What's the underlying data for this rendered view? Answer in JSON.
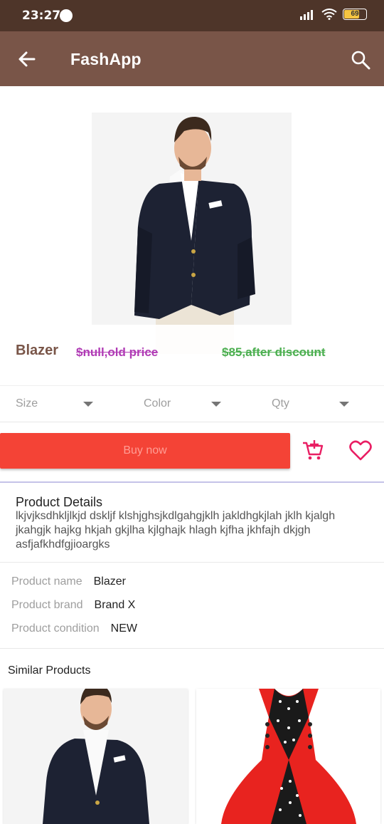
{
  "status": {
    "time": "23:27",
    "battery": "69"
  },
  "appbar": {
    "title": "FashApp"
  },
  "product": {
    "name": "Blazer",
    "old_price": "$null,old price",
    "new_price": "$85,after discount"
  },
  "selectors": {
    "size": "Size",
    "color": "Color",
    "qty": "Qty"
  },
  "actions": {
    "buy_now": "Buy now"
  },
  "details": {
    "title": "Product Details",
    "body": "lkjvjksdhkljlkjd dskljf klshjghsjkdlgahgjklh jakldhgkjlah jklh kjalgh jkahgjk hajkg hkjah gkjlha kjlghajk hlagh kjfha jkhfajh dkjgh asfjafkhdfgjioargks"
  },
  "info": [
    {
      "label": "Product name",
      "value": "Blazer"
    },
    {
      "label": "Product brand",
      "value": "Brand X"
    },
    {
      "label": "Product condition",
      "value": "NEW"
    }
  ],
  "similar": {
    "title": "Similar Products"
  },
  "colors": {
    "statusbar": "#4e3529",
    "appbar": "#795548",
    "buy": "#f44336",
    "accent": "#e91e63",
    "old_price": "#b03bb5",
    "new_price": "#4caf50"
  },
  "icons": [
    "back-arrow-icon",
    "search-icon",
    "add-to-cart-icon",
    "heart-outline-icon",
    "dropdown-caret-icon",
    "wifi-icon",
    "signal-icon",
    "battery-icon"
  ]
}
